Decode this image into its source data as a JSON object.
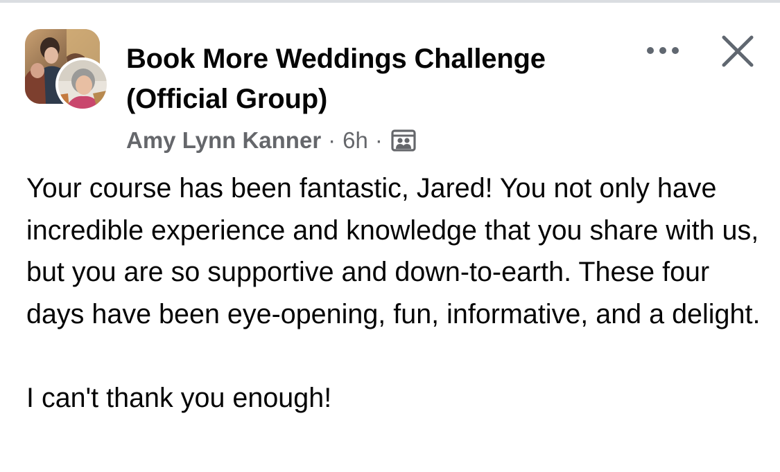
{
  "post": {
    "group_name": "Book More Weddings Challenge (Official Group)",
    "author": "Amy Lynn Kanner",
    "separator": "·",
    "time": "6h",
    "audience_icon": "group-members-icon",
    "body": "Your course has been fantastic, Jared! You not only have incredible experience and knowledge that you share with us, but you are so supportive and down-to-earth. These four days have been eye-opening, fun, informative, and a delight.\n\nI can't thank you enough!"
  },
  "icons": {
    "more": "more-options-icon",
    "close": "close-icon"
  },
  "colors": {
    "text_primary": "#050505",
    "text_secondary": "#65676b",
    "icon": "#606770"
  }
}
